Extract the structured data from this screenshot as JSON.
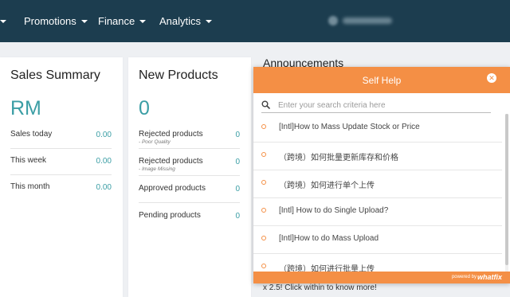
{
  "nav": {
    "items": [
      "Promotions",
      "Finance",
      "Analytics"
    ]
  },
  "sales_summary": {
    "title": "Sales Summary",
    "currency": "RM",
    "rows": [
      {
        "label": "Sales today",
        "value": "0.00"
      },
      {
        "label": "This week",
        "value": "0.00"
      },
      {
        "label": "This month",
        "value": "0.00"
      }
    ]
  },
  "new_products": {
    "title": "New Products",
    "count": "0",
    "rows": [
      {
        "label": "Rejected products",
        "sub": "- Poor Quality",
        "value": "0"
      },
      {
        "label": "Rejected products",
        "sub": "- Image Missing",
        "value": "0"
      },
      {
        "label": "Approved products",
        "sub": "",
        "value": "0"
      },
      {
        "label": "Pending products",
        "sub": "",
        "value": "0"
      }
    ]
  },
  "announcements": {
    "title": "Announcements",
    "footer_text": "x 2.5! Click within to know more!"
  },
  "self_help": {
    "title": "Self Help",
    "search_placeholder": "Enter your search criteria here",
    "items": [
      "[Intl]How to Mass Update Stock or Price",
      "（跨境）如何批量更新库存和价格",
      "（跨境）如何进行单个上传",
      "[Intl] How to do Single Upload?",
      "[Intl]How to do Mass Upload",
      "（跨境）如何进行批量上传"
    ],
    "powered_by": "powered by",
    "brand": "whatfix"
  },
  "colors": {
    "nav_bg": "#1c3d4f",
    "accent": "#f48f45",
    "value_teal": "#3b9ea5"
  }
}
